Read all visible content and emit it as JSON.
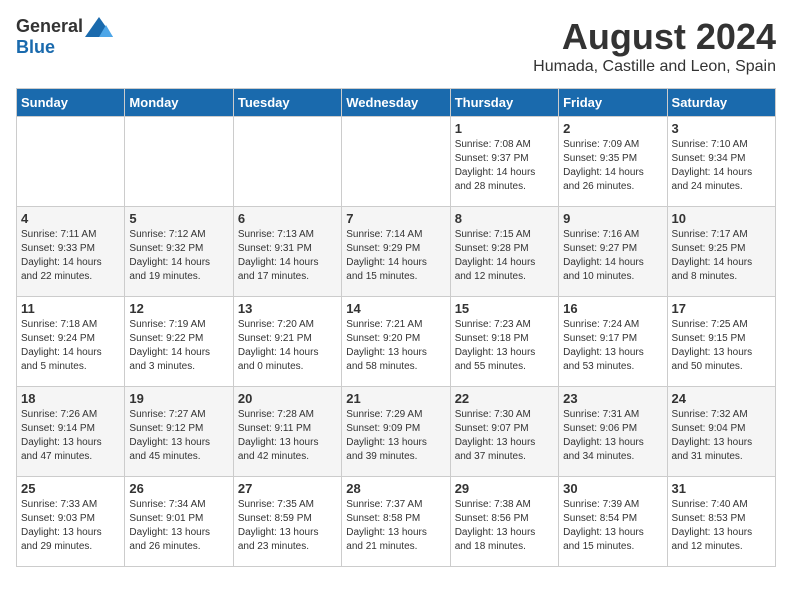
{
  "header": {
    "logo_general": "General",
    "logo_blue": "Blue",
    "title": "August 2024",
    "subtitle": "Humada, Castille and Leon, Spain"
  },
  "columns": [
    "Sunday",
    "Monday",
    "Tuesday",
    "Wednesday",
    "Thursday",
    "Friday",
    "Saturday"
  ],
  "weeks": [
    [
      {
        "day": "",
        "content": ""
      },
      {
        "day": "",
        "content": ""
      },
      {
        "day": "",
        "content": ""
      },
      {
        "day": "",
        "content": ""
      },
      {
        "day": "1",
        "content": "Sunrise: 7:08 AM\nSunset: 9:37 PM\nDaylight: 14 hours\nand 28 minutes."
      },
      {
        "day": "2",
        "content": "Sunrise: 7:09 AM\nSunset: 9:35 PM\nDaylight: 14 hours\nand 26 minutes."
      },
      {
        "day": "3",
        "content": "Sunrise: 7:10 AM\nSunset: 9:34 PM\nDaylight: 14 hours\nand 24 minutes."
      }
    ],
    [
      {
        "day": "4",
        "content": "Sunrise: 7:11 AM\nSunset: 9:33 PM\nDaylight: 14 hours\nand 22 minutes."
      },
      {
        "day": "5",
        "content": "Sunrise: 7:12 AM\nSunset: 9:32 PM\nDaylight: 14 hours\nand 19 minutes."
      },
      {
        "day": "6",
        "content": "Sunrise: 7:13 AM\nSunset: 9:31 PM\nDaylight: 14 hours\nand 17 minutes."
      },
      {
        "day": "7",
        "content": "Sunrise: 7:14 AM\nSunset: 9:29 PM\nDaylight: 14 hours\nand 15 minutes."
      },
      {
        "day": "8",
        "content": "Sunrise: 7:15 AM\nSunset: 9:28 PM\nDaylight: 14 hours\nand 12 minutes."
      },
      {
        "day": "9",
        "content": "Sunrise: 7:16 AM\nSunset: 9:27 PM\nDaylight: 14 hours\nand 10 minutes."
      },
      {
        "day": "10",
        "content": "Sunrise: 7:17 AM\nSunset: 9:25 PM\nDaylight: 14 hours\nand 8 minutes."
      }
    ],
    [
      {
        "day": "11",
        "content": "Sunrise: 7:18 AM\nSunset: 9:24 PM\nDaylight: 14 hours\nand 5 minutes."
      },
      {
        "day": "12",
        "content": "Sunrise: 7:19 AM\nSunset: 9:22 PM\nDaylight: 14 hours\nand 3 minutes."
      },
      {
        "day": "13",
        "content": "Sunrise: 7:20 AM\nSunset: 9:21 PM\nDaylight: 14 hours\nand 0 minutes."
      },
      {
        "day": "14",
        "content": "Sunrise: 7:21 AM\nSunset: 9:20 PM\nDaylight: 13 hours\nand 58 minutes."
      },
      {
        "day": "15",
        "content": "Sunrise: 7:23 AM\nSunset: 9:18 PM\nDaylight: 13 hours\nand 55 minutes."
      },
      {
        "day": "16",
        "content": "Sunrise: 7:24 AM\nSunset: 9:17 PM\nDaylight: 13 hours\nand 53 minutes."
      },
      {
        "day": "17",
        "content": "Sunrise: 7:25 AM\nSunset: 9:15 PM\nDaylight: 13 hours\nand 50 minutes."
      }
    ],
    [
      {
        "day": "18",
        "content": "Sunrise: 7:26 AM\nSunset: 9:14 PM\nDaylight: 13 hours\nand 47 minutes."
      },
      {
        "day": "19",
        "content": "Sunrise: 7:27 AM\nSunset: 9:12 PM\nDaylight: 13 hours\nand 45 minutes."
      },
      {
        "day": "20",
        "content": "Sunrise: 7:28 AM\nSunset: 9:11 PM\nDaylight: 13 hours\nand 42 minutes."
      },
      {
        "day": "21",
        "content": "Sunrise: 7:29 AM\nSunset: 9:09 PM\nDaylight: 13 hours\nand 39 minutes."
      },
      {
        "day": "22",
        "content": "Sunrise: 7:30 AM\nSunset: 9:07 PM\nDaylight: 13 hours\nand 37 minutes."
      },
      {
        "day": "23",
        "content": "Sunrise: 7:31 AM\nSunset: 9:06 PM\nDaylight: 13 hours\nand 34 minutes."
      },
      {
        "day": "24",
        "content": "Sunrise: 7:32 AM\nSunset: 9:04 PM\nDaylight: 13 hours\nand 31 minutes."
      }
    ],
    [
      {
        "day": "25",
        "content": "Sunrise: 7:33 AM\nSunset: 9:03 PM\nDaylight: 13 hours\nand 29 minutes."
      },
      {
        "day": "26",
        "content": "Sunrise: 7:34 AM\nSunset: 9:01 PM\nDaylight: 13 hours\nand 26 minutes."
      },
      {
        "day": "27",
        "content": "Sunrise: 7:35 AM\nSunset: 8:59 PM\nDaylight: 13 hours\nand 23 minutes."
      },
      {
        "day": "28",
        "content": "Sunrise: 7:37 AM\nSunset: 8:58 PM\nDaylight: 13 hours\nand 21 minutes."
      },
      {
        "day": "29",
        "content": "Sunrise: 7:38 AM\nSunset: 8:56 PM\nDaylight: 13 hours\nand 18 minutes."
      },
      {
        "day": "30",
        "content": "Sunrise: 7:39 AM\nSunset: 8:54 PM\nDaylight: 13 hours\nand 15 minutes."
      },
      {
        "day": "31",
        "content": "Sunrise: 7:40 AM\nSunset: 8:53 PM\nDaylight: 13 hours\nand 12 minutes."
      }
    ]
  ]
}
